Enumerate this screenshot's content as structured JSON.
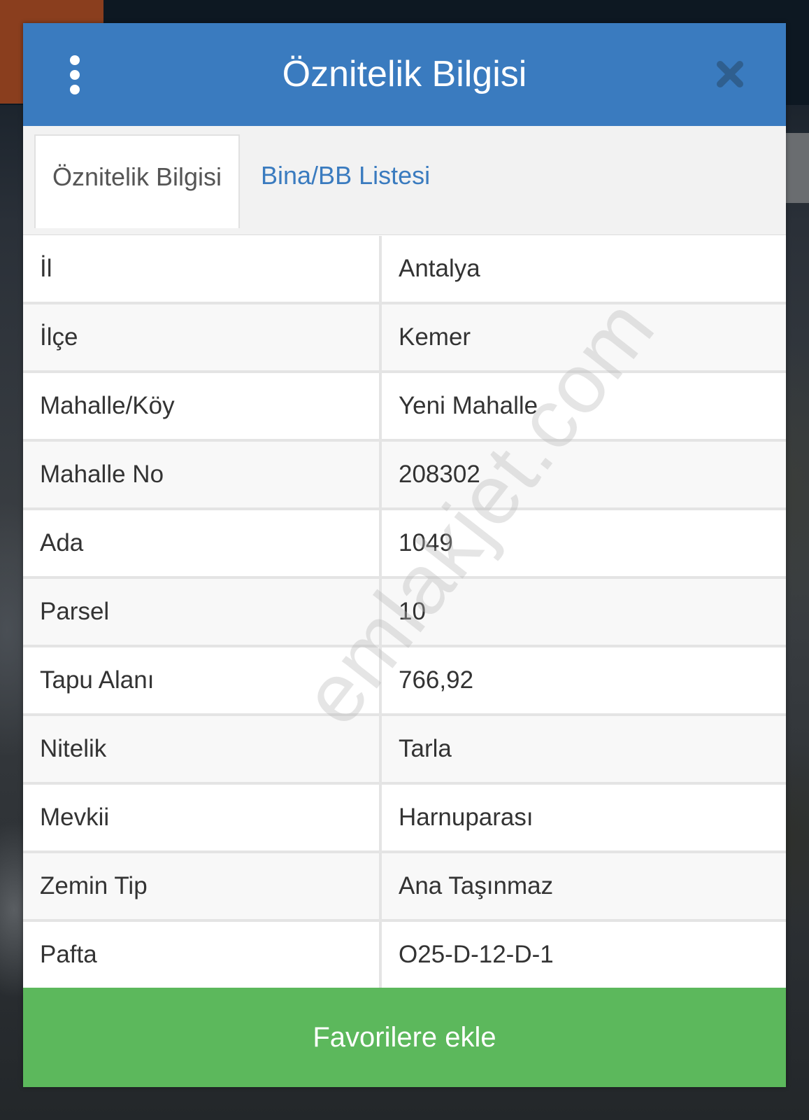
{
  "header": {
    "title": "Öznitelik Bilgisi"
  },
  "tabs": [
    {
      "label": "Öznitelik Bilgisi",
      "active": true
    },
    {
      "label": "Bina/BB Listesi",
      "active": false
    }
  ],
  "attributes": [
    {
      "label": "İl",
      "value": "Antalya"
    },
    {
      "label": "İlçe",
      "value": "Kemer"
    },
    {
      "label": "Mahalle/Köy",
      "value": "Yeni Mahalle"
    },
    {
      "label": "Mahalle No",
      "value": "208302"
    },
    {
      "label": "Ada",
      "value": "1049"
    },
    {
      "label": "Parsel",
      "value": "10"
    },
    {
      "label": "Tapu Alanı",
      "value": "766,92"
    },
    {
      "label": "Nitelik",
      "value": "Tarla"
    },
    {
      "label": "Mevkii",
      "value": "Harnuparası"
    },
    {
      "label": "Zemin Tip",
      "value": "Ana Taşınmaz"
    },
    {
      "label": "Pafta",
      "value": "O25-D-12-D-1"
    }
  ],
  "footer": {
    "favorite_label": "Favorilere ekle"
  },
  "watermark": "emlakjet.com",
  "colors": {
    "header": "#3a7bbf",
    "tab_active_text": "#555555",
    "tab_link": "#3a7bbf",
    "favorite_button": "#5cb85c"
  },
  "icons": {
    "menu": "vertical-dots-icon",
    "close": "close-icon"
  }
}
